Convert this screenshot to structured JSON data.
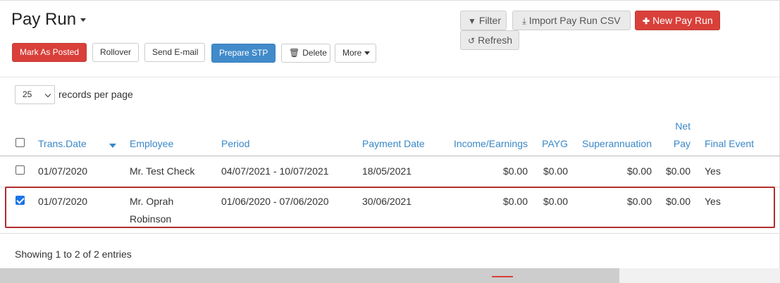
{
  "page": {
    "title": "Pay Run"
  },
  "toolbar": {
    "mark_as_posted": "Mark As Posted",
    "rollover": "Rollover",
    "send_email": "Send E-mail",
    "prepare_stp": "Prepare STP",
    "delete": "Delete",
    "more": "More"
  },
  "actions": {
    "filter": "Filter",
    "import_csv": "Import Pay Run CSV",
    "new_pay_run": "New Pay Run",
    "refresh": "Refresh"
  },
  "pagination": {
    "page_size": "25",
    "per_page_label": "records per page",
    "info": "Showing 1 to 2 of 2 entries"
  },
  "table": {
    "headers": {
      "trans_date": "Trans.Date",
      "employee": "Employee",
      "period": "Period",
      "payment_date": "Payment Date",
      "income": "Income/Earnings",
      "payg": "PAYG",
      "super": "Superannuation",
      "net_pay_line1": "Net",
      "net_pay_line2": "Pay",
      "final_event": "Final Event"
    },
    "rows": [
      {
        "checked": false,
        "trans_date": "01/07/2020",
        "employee_line1": "Mr. Test Check",
        "employee_line2": "",
        "period": "04/07/2021 - 10/07/2021",
        "payment_date": "18/05/2021",
        "income": "$0.00",
        "payg": "$0.00",
        "super": "$0.00",
        "net_pay": "$0.00",
        "final_event": "Yes"
      },
      {
        "checked": true,
        "trans_date": "01/07/2020",
        "employee_line1": "Mr. Oprah",
        "employee_line2": "Robinson",
        "period": "01/06/2020 - 07/06/2020",
        "payment_date": "30/06/2021",
        "income": "$0.00",
        "payg": "$0.00",
        "super": "$0.00",
        "net_pay": "$0.00",
        "final_event": "Yes"
      }
    ]
  },
  "colors": {
    "link": "#3a87c8",
    "danger": "#d9403a",
    "primary": "#428bca",
    "highlight_border": "#b22c2c"
  }
}
